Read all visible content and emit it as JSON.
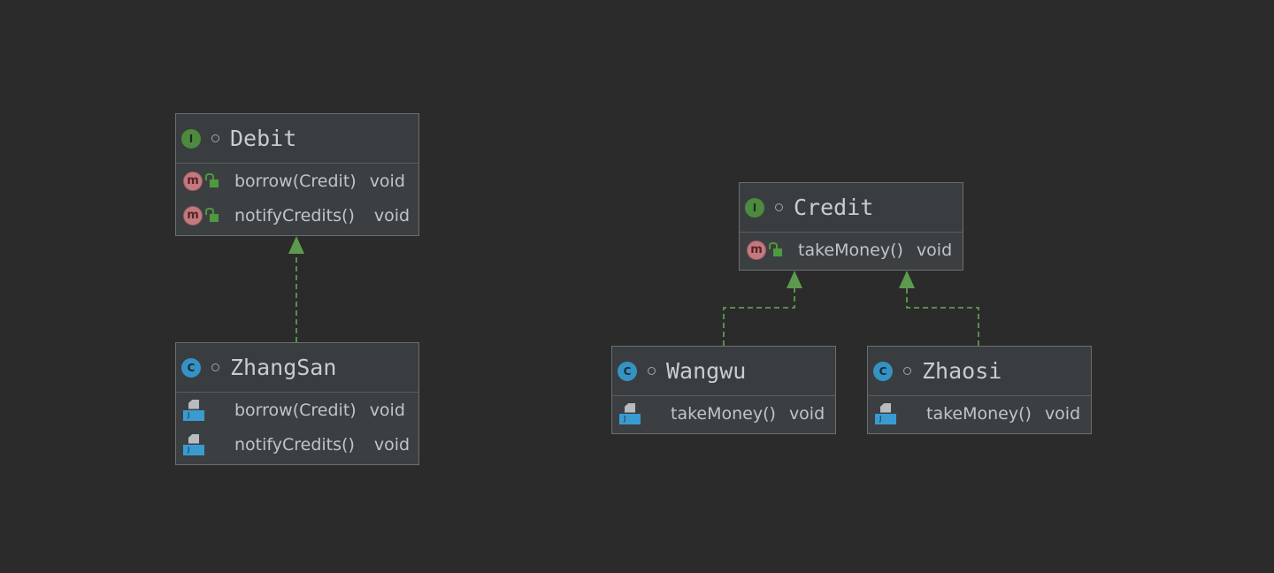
{
  "nodes": {
    "debit": {
      "kind": "interface",
      "kind_icon": "I",
      "name": "Debit",
      "methods": [
        {
          "signature": "borrow(Credit)",
          "return": "void"
        },
        {
          "signature": "notifyCredits()",
          "return": "void"
        }
      ]
    },
    "zhangsan": {
      "kind": "class",
      "kind_icon": "C",
      "name": "ZhangSan",
      "methods": [
        {
          "signature": "borrow(Credit)",
          "return": "void"
        },
        {
          "signature": "notifyCredits()",
          "return": "void"
        }
      ]
    },
    "credit": {
      "kind": "interface",
      "kind_icon": "I",
      "name": "Credit",
      "methods": [
        {
          "signature": "takeMoney()",
          "return": "void"
        }
      ]
    },
    "wangwu": {
      "kind": "class",
      "kind_icon": "C",
      "name": "Wangwu",
      "methods": [
        {
          "signature": "takeMoney()",
          "return": "void"
        }
      ]
    },
    "zhaosi": {
      "kind": "class",
      "kind_icon": "C",
      "name": "Zhaosi",
      "methods": [
        {
          "signature": "takeMoney()",
          "return": "void"
        }
      ]
    }
  },
  "edges": [
    {
      "from": "ZhangSan",
      "to": "Debit",
      "type": "implements"
    },
    {
      "from": "Wangwu",
      "to": "Credit",
      "type": "implements"
    },
    {
      "from": "Zhaosi",
      "to": "Credit",
      "type": "implements"
    }
  ],
  "colors": {
    "background": "#2b2b2b",
    "edge": "#5e9a4e",
    "interface": "#4e8a3e",
    "class": "#3592c4",
    "method": "#c27a7f"
  }
}
